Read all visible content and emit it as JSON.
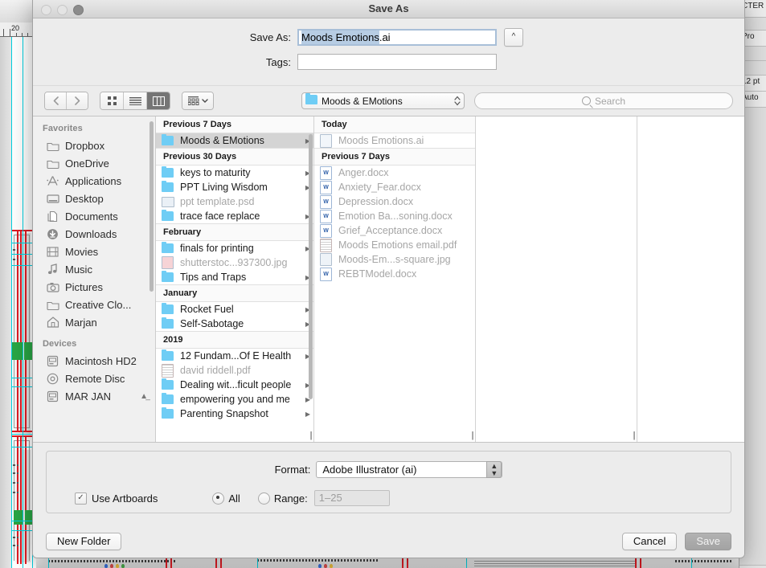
{
  "background": {
    "ruler_label": "20",
    "right_panel": [
      {
        "text": "CTER"
      },
      {
        "text": ""
      },
      {
        "text": "Pro"
      },
      {
        "text": ""
      },
      {
        "text": ""
      },
      {
        "text": "12 pt"
      },
      {
        "text": "Auto"
      },
      {
        "text": ""
      }
    ]
  },
  "dialog": {
    "title": "Save As",
    "traffic_lights": [
      "close-button",
      "minimize-button",
      "zoom-button"
    ]
  },
  "name_area": {
    "save_as_label": "Save As:",
    "file_name_selected": "Moods Emotions",
    "file_name_extension": ".ai",
    "disclosure_icon": "chevron-up-icon",
    "tags_label": "Tags:",
    "tags_value": "",
    "tags_placeholder": ""
  },
  "toolbar": {
    "back_icon": "chevron-left-icon",
    "forward_icon": "chevron-right-icon",
    "view_icon_grid": "icon-view-icon",
    "view_icon_list": "list-view-icon",
    "view_icon_column": "column-view-icon",
    "arrange_icon": "arrange-items-icon",
    "arrange_chevron": "chevron-down-icon",
    "path_folder_icon": "folder-icon",
    "path_label": "Moods & EMotions",
    "path_stepper_icon": "up-down-stepper-icon",
    "search_icon": "search-icon",
    "search_placeholder": "Search",
    "search_value": ""
  },
  "sidebar": {
    "sections": [
      {
        "header": "Favorites",
        "items": [
          {
            "label": "Dropbox",
            "icon": "folder-icon",
            "eject": false
          },
          {
            "label": "OneDrive",
            "icon": "folder-icon",
            "eject": false
          },
          {
            "label": "Applications",
            "icon": "applications-icon",
            "eject": false
          },
          {
            "label": "Desktop",
            "icon": "desktop-icon",
            "eject": false
          },
          {
            "label": "Documents",
            "icon": "documents-icon",
            "eject": false
          },
          {
            "label": "Downloads",
            "icon": "downloads-icon",
            "eject": false
          },
          {
            "label": "Movies",
            "icon": "movies-icon",
            "eject": false
          },
          {
            "label": "Music",
            "icon": "music-icon",
            "eject": false
          },
          {
            "label": "Pictures",
            "icon": "pictures-icon",
            "eject": false
          },
          {
            "label": "Creative Clo...",
            "icon": "folder-icon",
            "eject": false
          },
          {
            "label": "Marjan",
            "icon": "home-icon",
            "eject": false
          }
        ]
      },
      {
        "header": "Devices",
        "items": [
          {
            "label": "Macintosh HD2",
            "icon": "hard-drive-icon",
            "eject": false
          },
          {
            "label": "Remote Disc",
            "icon": "disc-icon",
            "eject": false
          },
          {
            "label": "MAR JAN",
            "icon": "hard-drive-icon",
            "eject": true
          }
        ]
      }
    ],
    "eject_icon": "eject-icon"
  },
  "columns": [
    {
      "groups": [
        {
          "header": "Previous 7 Days",
          "rows": [
            {
              "name": "Moods & EMotions",
              "icon": "folder-icon",
              "chevron": true,
              "dim": false,
              "selected": true
            }
          ]
        },
        {
          "header": "Previous 30 Days",
          "rows": [
            {
              "name": "keys to maturity",
              "icon": "folder-icon",
              "chevron": true,
              "dim": false,
              "selected": false
            },
            {
              "name": "PPT Living Wisdom",
              "icon": "folder-icon",
              "chevron": true,
              "dim": false,
              "selected": false
            },
            {
              "name": "ppt template.psd",
              "icon": "psd-file-icon",
              "chevron": false,
              "dim": true,
              "selected": false
            },
            {
              "name": "trace face replace",
              "icon": "folder-icon",
              "chevron": true,
              "dim": false,
              "selected": false
            }
          ]
        },
        {
          "header": "February",
          "rows": [
            {
              "name": "finals for printing",
              "icon": "folder-icon",
              "chevron": true,
              "dim": false,
              "selected": false
            },
            {
              "name": "shutterstoc...937300.jpg",
              "icon": "image-file-icon",
              "chevron": false,
              "dim": true,
              "selected": false
            },
            {
              "name": "Tips and Traps",
              "icon": "folder-icon",
              "chevron": true,
              "dim": false,
              "selected": false
            }
          ]
        },
        {
          "header": "January",
          "rows": [
            {
              "name": "Rocket Fuel",
              "icon": "folder-icon",
              "chevron": true,
              "dim": false,
              "selected": false
            },
            {
              "name": "Self-Sabotage",
              "icon": "folder-icon",
              "chevron": true,
              "dim": false,
              "selected": false
            }
          ]
        },
        {
          "header": "2019",
          "rows": [
            {
              "name": "12 Fundam...Of E Health",
              "icon": "folder-icon",
              "chevron": true,
              "dim": false,
              "selected": false
            },
            {
              "name": "david riddell.pdf",
              "icon": "pdf-file-icon",
              "chevron": false,
              "dim": true,
              "selected": false
            },
            {
              "name": "Dealing wit...ficult people",
              "icon": "folder-icon",
              "chevron": true,
              "dim": false,
              "selected": false
            },
            {
              "name": "empowering you and me",
              "icon": "folder-icon",
              "chevron": true,
              "dim": false,
              "selected": false
            },
            {
              "name": "Parenting Snapshot",
              "icon": "folder-icon",
              "chevron": true,
              "dim": false,
              "selected": false
            }
          ]
        }
      ],
      "resize_handle": "column-resize-handle"
    },
    {
      "groups": [
        {
          "header": "Today",
          "rows": [
            {
              "name": "Moods Emotions.ai",
              "icon": "ai-file-icon",
              "chevron": false,
              "dim": true,
              "selected": false
            }
          ]
        },
        {
          "header": "Previous 7 Days",
          "rows": [
            {
              "name": "Anger.docx",
              "icon": "word-file-icon",
              "chevron": false,
              "dim": true,
              "selected": false
            },
            {
              "name": "Anxiety_Fear.docx",
              "icon": "word-file-icon",
              "chevron": false,
              "dim": true,
              "selected": false
            },
            {
              "name": "Depression.docx",
              "icon": "word-file-icon",
              "chevron": false,
              "dim": true,
              "selected": false
            },
            {
              "name": "Emotion Ba...soning.docx",
              "icon": "word-file-icon",
              "chevron": false,
              "dim": true,
              "selected": false
            },
            {
              "name": "Grief_Acceptance.docx",
              "icon": "word-file-icon",
              "chevron": false,
              "dim": true,
              "selected": false
            },
            {
              "name": "Moods Emotions email.pdf",
              "icon": "pdf-file-icon",
              "chevron": false,
              "dim": true,
              "selected": false
            },
            {
              "name": "Moods-Em...s-square.jpg",
              "icon": "image-file-icon",
              "chevron": false,
              "dim": true,
              "selected": false
            },
            {
              "name": "REBTModel.docx",
              "icon": "word-file-icon",
              "chevron": false,
              "dim": true,
              "selected": false
            }
          ]
        }
      ],
      "resize_handle": "column-resize-handle"
    }
  ],
  "options": {
    "format_label": "Format:",
    "format_value": "Adobe Illustrator (ai)",
    "format_stepper_icon": "up-down-stepper-icon",
    "use_artboards_label": "Use Artboards",
    "use_artboards_checked": true,
    "check_glyph": "✓",
    "all_label": "All",
    "all_selected": true,
    "range_label": "Range:",
    "range_selected": false,
    "range_value": "1–25"
  },
  "footer": {
    "new_folder_label": "New Folder",
    "cancel_label": "Cancel",
    "save_label": "Save",
    "save_disabled": true
  },
  "colors": {
    "selection_blue": "#b7cde4",
    "folder_blue": "#6fcdf5",
    "guide_cyan": "#00d0e0",
    "artwork_red": "#e01b24",
    "artwork_green": "#29a745"
  }
}
